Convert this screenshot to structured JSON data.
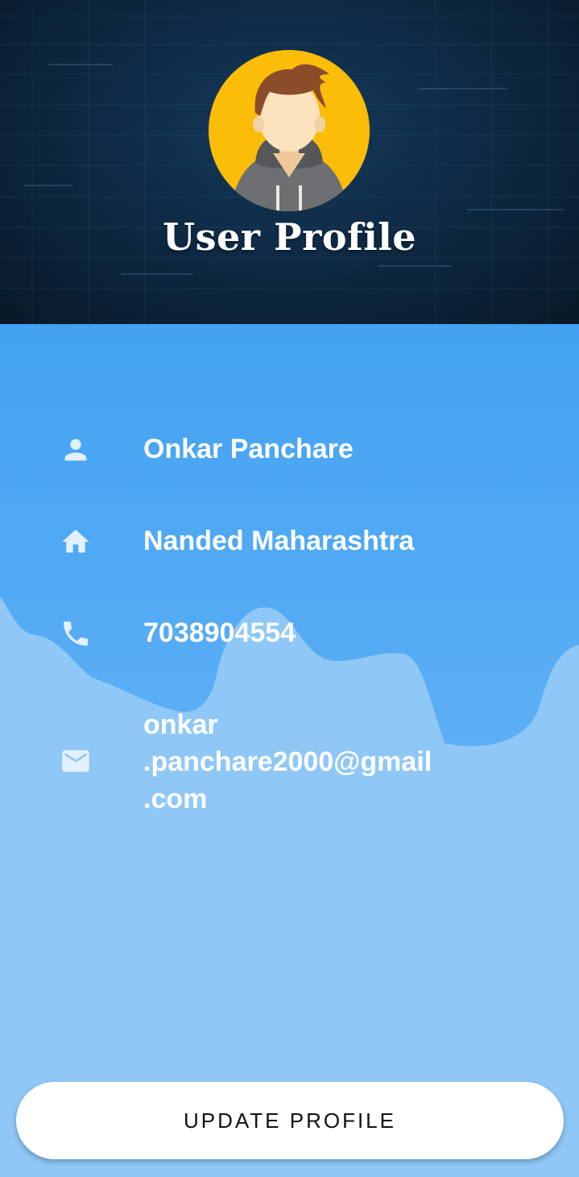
{
  "header": {
    "title": "User Profile",
    "avatar_icon": "user-avatar",
    "background_color": "#0e2a45"
  },
  "profile": {
    "name": "Onkar Panchare",
    "address": "Nanded Maharashtra",
    "phone": "7038904554",
    "email_lines": [
      "onkar",
      ".panchare2000@gmail",
      ".com"
    ]
  },
  "icons": {
    "name": "person-icon",
    "address": "home-icon",
    "phone": "phone-icon",
    "email": "mail-icon"
  },
  "actions": {
    "update_label": "UPDATE PROFILE"
  },
  "colors": {
    "content_top": "#43a2f3",
    "content_bottom": "#8fc8f6",
    "button": "#ffffff",
    "text": "#ffffff"
  }
}
